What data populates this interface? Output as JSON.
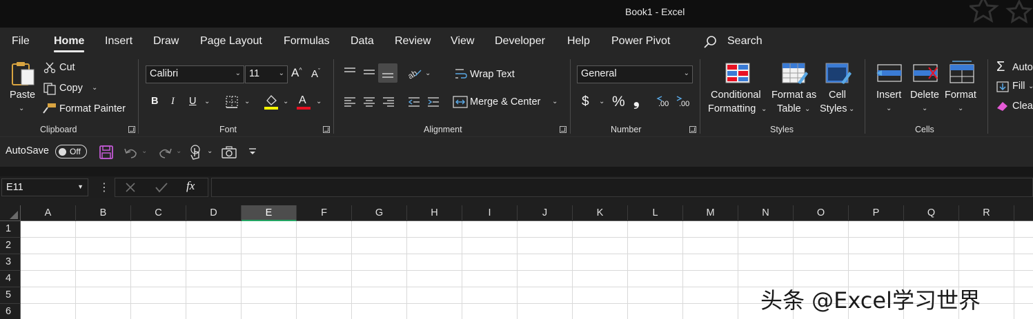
{
  "window": {
    "title": "Book1  -  Excel"
  },
  "menu": {
    "tabs": [
      "File",
      "Home",
      "Insert",
      "Draw",
      "Page Layout",
      "Formulas",
      "Data",
      "Review",
      "View",
      "Developer",
      "Help",
      "Power Pivot"
    ],
    "active_tab": "Home",
    "search_label": "Search"
  },
  "ribbon": {
    "clipboard": {
      "paste": "Paste",
      "cut": "Cut",
      "copy": "Copy",
      "format_painter": "Format Painter",
      "label": "Clipboard"
    },
    "font": {
      "name": "Calibri",
      "size": "11",
      "bold": "B",
      "italic": "I",
      "underline": "U",
      "font_color_letter": "A",
      "label": "Font",
      "highlight_color": "#ffff00",
      "font_color": "#e81123"
    },
    "alignment": {
      "wrap_text": "Wrap Text",
      "merge_center": "Merge & Center",
      "label": "Alignment"
    },
    "number": {
      "format": "General",
      "currency": "$",
      "percent": "%",
      "comma": "❟",
      "inc_decimal": ".00",
      "dec_decimal": ".00",
      "label": "Number"
    },
    "styles": {
      "conditional_1": "Conditional",
      "conditional_2": "Formatting",
      "format_table_1": "Format as",
      "format_table_2": "Table",
      "cell_styles_1": "Cell",
      "cell_styles_2": "Styles",
      "label": "Styles"
    },
    "cells": {
      "insert": "Insert",
      "delete": "Delete",
      "format": "Format",
      "label": "Cells"
    },
    "editing": {
      "autosum": "Auto",
      "fill": "Fill",
      "clear": "Clea"
    }
  },
  "qat": {
    "autosave_label": "AutoSave",
    "autosave_state": "Off"
  },
  "formula_bar": {
    "name_box": "E11",
    "fx": "fx",
    "value": ""
  },
  "grid": {
    "columns": [
      "A",
      "B",
      "C",
      "D",
      "E",
      "F",
      "G",
      "H",
      "I",
      "J",
      "K",
      "L",
      "M",
      "N",
      "O",
      "P",
      "Q",
      "R"
    ],
    "selected_column": "E",
    "rows": [
      "1",
      "2",
      "3",
      "4",
      "5",
      "6"
    ]
  },
  "watermark": "头条 @Excel学习世界",
  "colors": {
    "accent_green": "#22a462",
    "ribbon_bg": "#262626",
    "title_bg": "#0f0f0f"
  }
}
